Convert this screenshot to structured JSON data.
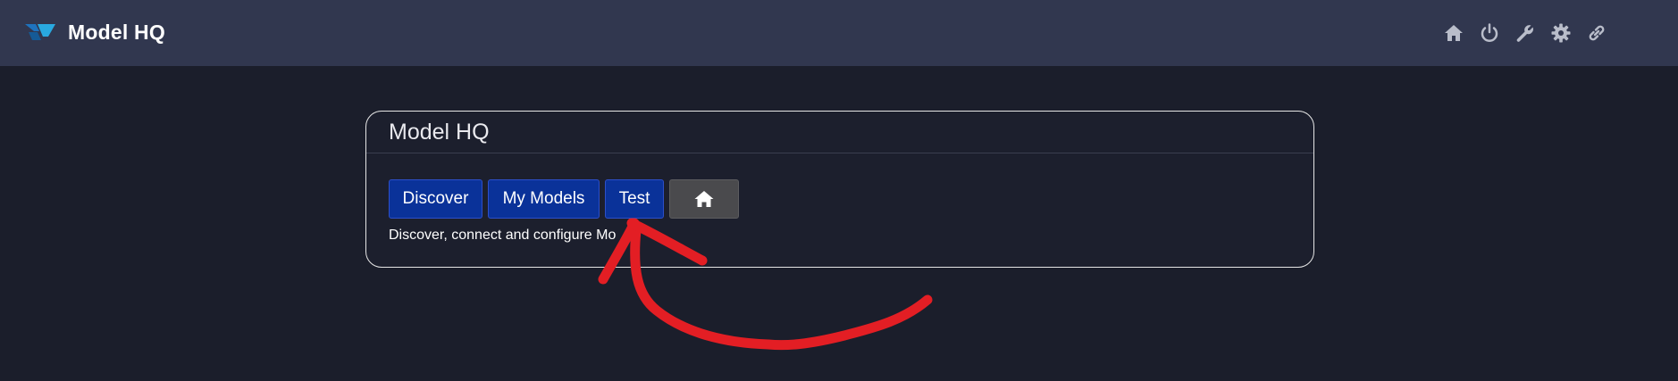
{
  "header": {
    "app_title": "Model HQ",
    "logo_icon": "model-hq-logo",
    "nav_icons": [
      "home-icon",
      "power-icon",
      "wrench-icon",
      "gear-icon",
      "link-icon"
    ]
  },
  "card": {
    "title": "Model HQ",
    "buttons": {
      "discover": "Discover",
      "my_models": "My Models",
      "test": "Test",
      "home_icon": "home-icon"
    },
    "description": "Discover, connect and configure Mo"
  },
  "annotation": {
    "type": "red hand-drawn arrow pointing to Test button",
    "color": "#e31e24"
  },
  "colors": {
    "topbar": "#31374f",
    "background": "#1b1e2b",
    "primary_button": "#0a3299",
    "home_button": "#4a4a4d"
  }
}
